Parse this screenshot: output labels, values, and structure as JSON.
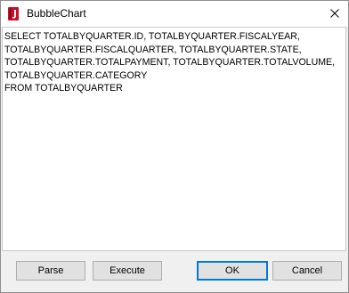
{
  "window": {
    "title": "BubbleChart"
  },
  "editor": {
    "sql": "SELECT TOTALBYQUARTER.ID, TOTALBYQUARTER.FISCALYEAR,\nTOTALBYQUARTER.FISCALQUARTER, TOTALBYQUARTER.STATE,\nTOTALBYQUARTER.TOTALPAYMENT, TOTALBYQUARTER.TOTALVOLUME,\nTOTALBYQUARTER.CATEGORY\nFROM TOTALBYQUARTER"
  },
  "buttons": {
    "parse": "Parse",
    "execute": "Execute",
    "ok": "OK",
    "cancel": "Cancel"
  },
  "colors": {
    "app_icon": "#c8102e",
    "ok_focus": "#0078d7"
  },
  "icons": {
    "app": "report-app-icon",
    "close": "close-icon"
  }
}
